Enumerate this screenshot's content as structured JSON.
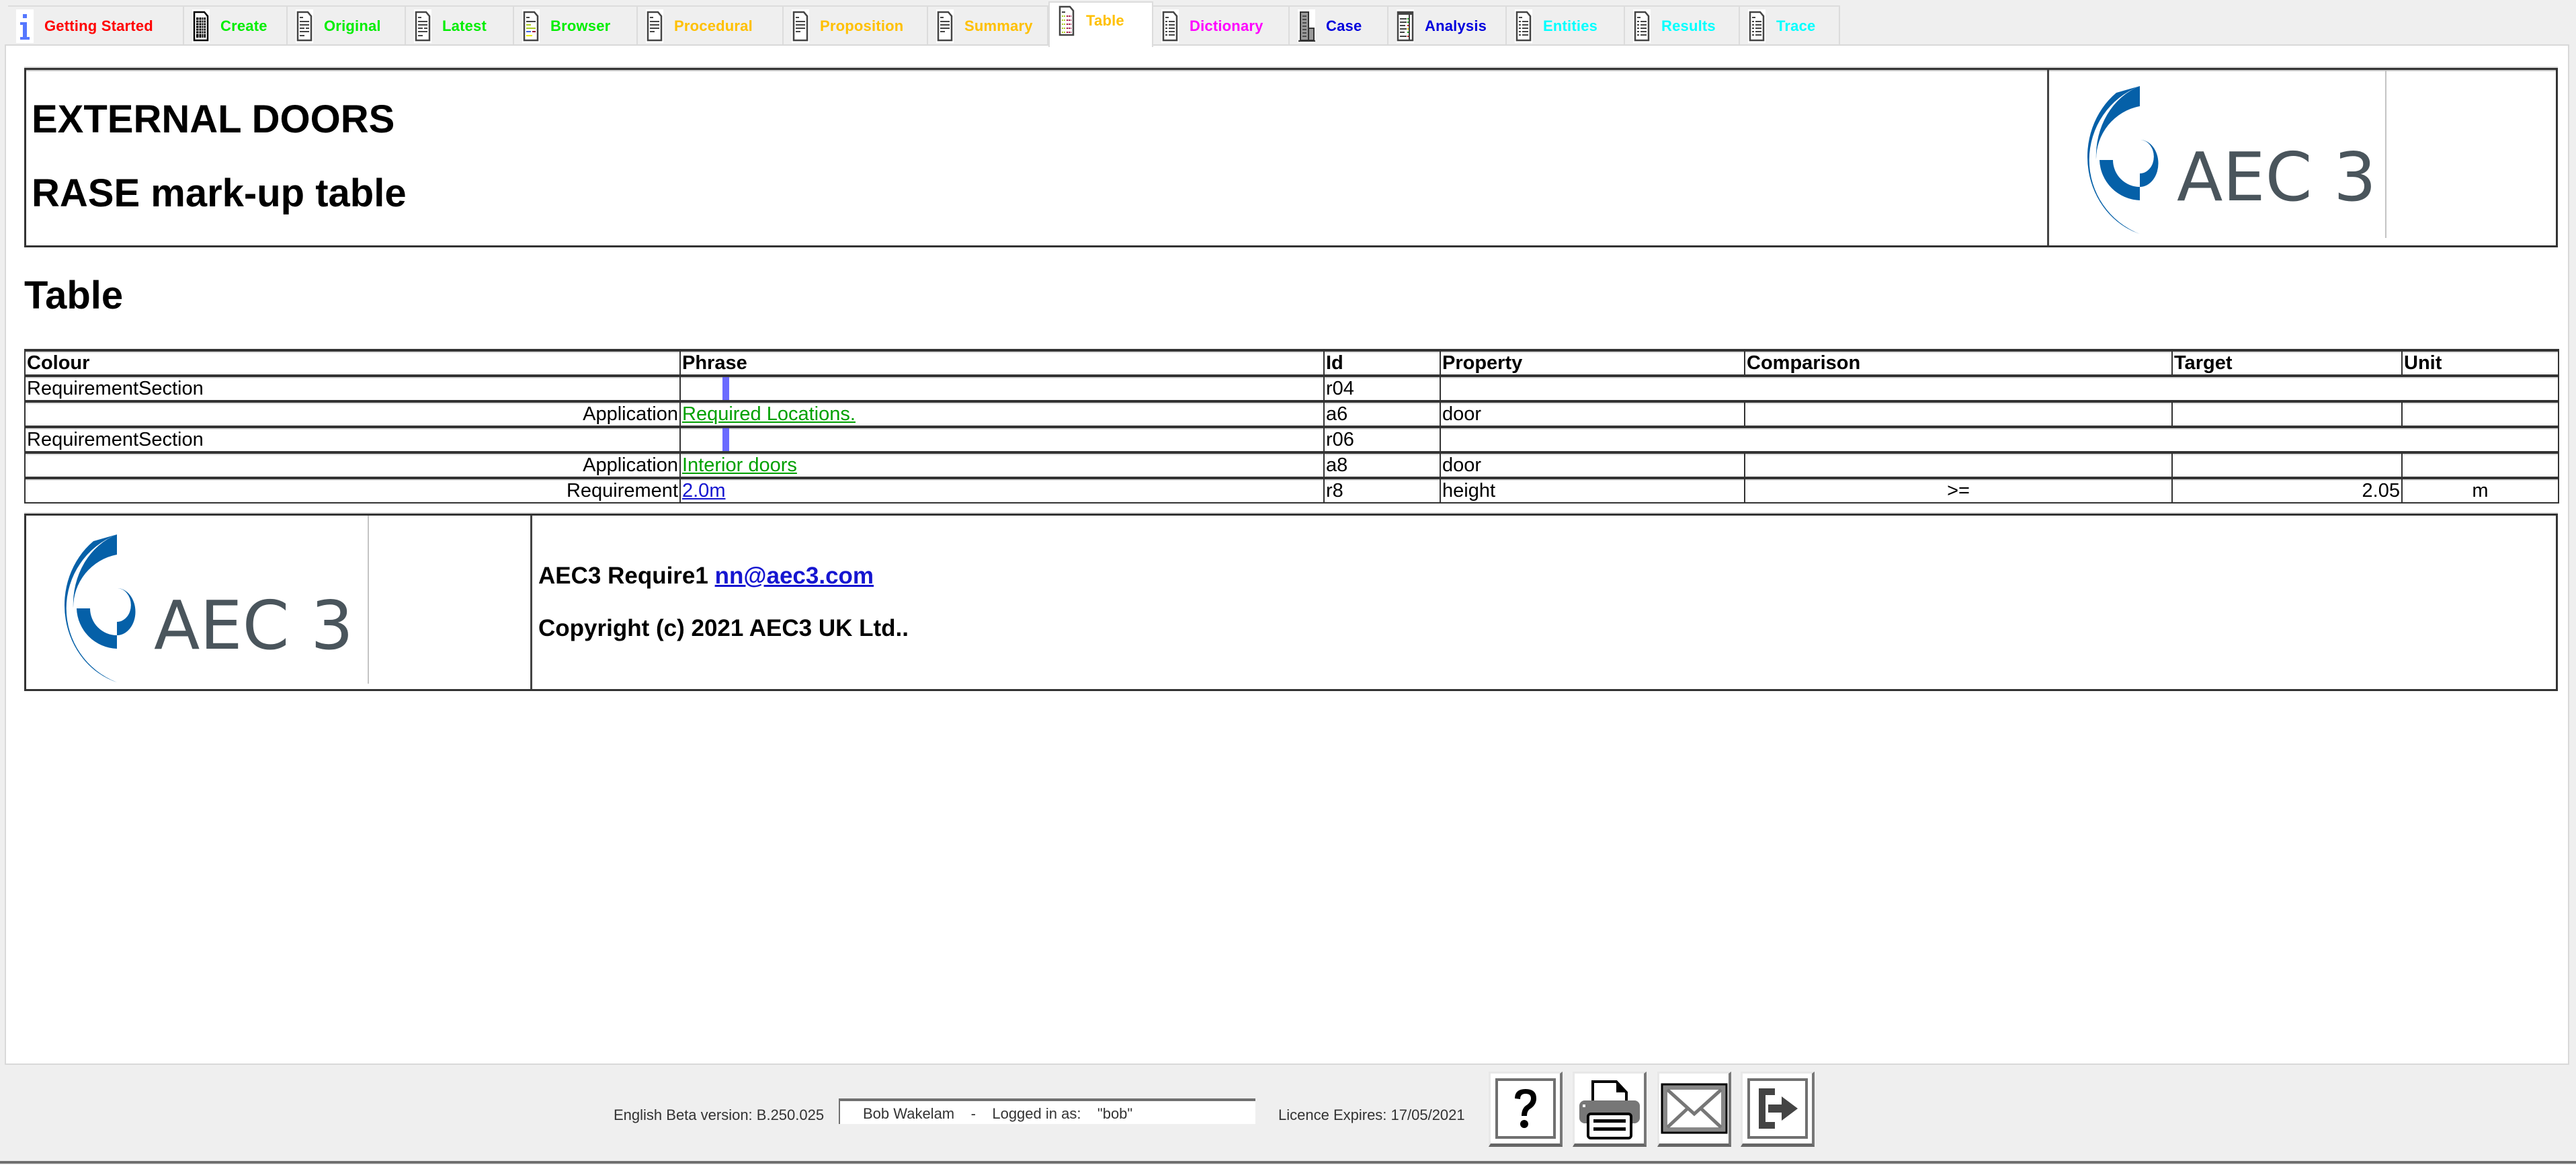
{
  "tabs": [
    {
      "label": "Getting Started",
      "color": "#ff0000",
      "icon": "info-icon",
      "active": false
    },
    {
      "label": "Create",
      "color": "#00ee00",
      "icon": "document-grid-icon",
      "active": false
    },
    {
      "label": "Original",
      "color": "#00ee00",
      "icon": "document-icon",
      "active": false
    },
    {
      "label": "Latest",
      "color": "#00ee00",
      "icon": "document-icon",
      "active": false
    },
    {
      "label": "Browser",
      "color": "#00ee00",
      "icon": "document-colored-icon",
      "active": false
    },
    {
      "label": "Procedural",
      "color": "#ffc000",
      "icon": "document-lines-icon",
      "active": false
    },
    {
      "label": "Proposition",
      "color": "#ffc000",
      "icon": "document-lines-icon",
      "active": false
    },
    {
      "label": "Summary",
      "color": "#ffc000",
      "icon": "document-lines-icon",
      "active": false
    },
    {
      "label": "Table",
      "color": "#ffc000",
      "icon": "document-table-icon",
      "active": true
    },
    {
      "label": "Dictionary",
      "color": "#ff00ff",
      "icon": "document-list-icon",
      "active": false
    },
    {
      "label": "Case",
      "color": "#0000dd",
      "icon": "building-icon",
      "active": false
    },
    {
      "label": "Analysis",
      "color": "#0000dd",
      "icon": "document-analysis-icon",
      "active": false
    },
    {
      "label": "Entities",
      "color": "#00ffff",
      "icon": "document-list-icon",
      "active": false
    },
    {
      "label": "Results",
      "color": "#00ffff",
      "icon": "document-list-icon",
      "active": false
    },
    {
      "label": "Trace",
      "color": "#00ffff",
      "icon": "document-list-icon",
      "active": false
    }
  ],
  "header": {
    "title": "EXTERNAL DOORS",
    "subtitle": "RASE mark-up table",
    "logo_text": "AEC 3"
  },
  "section_title": "Table",
  "table": {
    "columns": [
      "Colour",
      "Phrase",
      "Id",
      "Property",
      "Comparison",
      "Target",
      "Unit"
    ],
    "rows": [
      {
        "colour": "RequirementSection",
        "phrase": "",
        "phrase_type": "bar",
        "id": "r04",
        "property": "",
        "comparison": "",
        "target": "",
        "unit": "",
        "merged": true
      },
      {
        "colour": "Application",
        "phrase": "Required Locations.",
        "phrase_type": "green-link",
        "id": "a6",
        "property": "door",
        "comparison": "",
        "target": "",
        "unit": "",
        "merged": false
      },
      {
        "colour": "RequirementSection",
        "phrase": "",
        "phrase_type": "bar",
        "id": "r06",
        "property": "",
        "comparison": "",
        "target": "",
        "unit": "",
        "merged": true
      },
      {
        "colour": "Application",
        "phrase": "Interior doors",
        "phrase_type": "green-link",
        "id": "a8",
        "property": "door",
        "comparison": "",
        "target": "",
        "unit": "",
        "merged": false
      },
      {
        "colour": "Requirement",
        "phrase": "2.0m",
        "phrase_type": "blue-link",
        "id": "r8",
        "property": "height",
        "comparison": ">=",
        "target": "2.05",
        "unit": "m",
        "merged": false
      }
    ]
  },
  "footer": {
    "product": "AEC3 Require1",
    "email": "nn@aec3.com",
    "copyright": "Copyright (c) 2021 AEC3 UK Ltd..",
    "logo_text": "AEC 3"
  },
  "statusbar": {
    "version": "English Beta version: B.250.025",
    "user": "Bob Wakelam    -    Logged in as:    \"bob\"",
    "licence": "Licence Expires: 17/05/2021",
    "buttons": [
      {
        "name": "help",
        "icon": "question-icon"
      },
      {
        "name": "print",
        "icon": "printer-icon"
      },
      {
        "name": "email",
        "icon": "envelope-icon"
      },
      {
        "name": "logout",
        "icon": "exit-icon"
      }
    ]
  },
  "colors": {
    "logo_blue": "#0560a8",
    "logo_gray": "#4a555c",
    "phrase_bar": "#6b6bff",
    "link_green": "#00a000",
    "link_blue": "#1515d0"
  }
}
